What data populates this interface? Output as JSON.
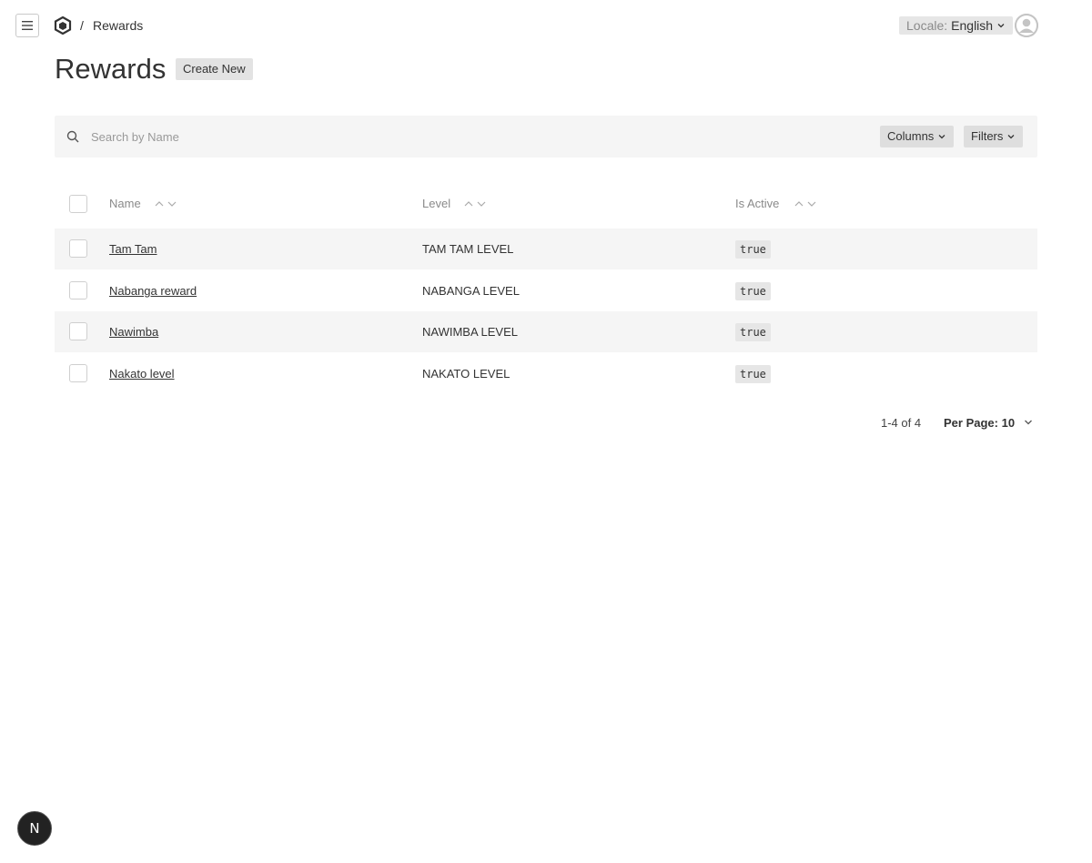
{
  "header": {
    "breadcrumb_sep": "/",
    "breadcrumb_current": "Rewards",
    "locale_label": "Locale:",
    "locale_value": "English"
  },
  "page": {
    "title": "Rewards",
    "create_label": "Create New"
  },
  "toolbar": {
    "search_placeholder": "Search by Name",
    "columns_label": "Columns",
    "filters_label": "Filters"
  },
  "table": {
    "headers": [
      "Name",
      "Level",
      "Is Active"
    ],
    "rows": [
      {
        "name": "Tam Tam",
        "level": "TAM TAM LEVEL",
        "active": "true"
      },
      {
        "name": "Nabanga reward",
        "level": "NABANGA LEVEL",
        "active": "true"
      },
      {
        "name": "Nawimba",
        "level": "NAWIMBA LEVEL",
        "active": "true"
      },
      {
        "name": "Nakato level",
        "level": "NAKATO LEVEL",
        "active": "true"
      }
    ]
  },
  "pagination": {
    "count": "1-4 of 4",
    "per_page": "Per Page: 10"
  },
  "dev_badge": "N"
}
